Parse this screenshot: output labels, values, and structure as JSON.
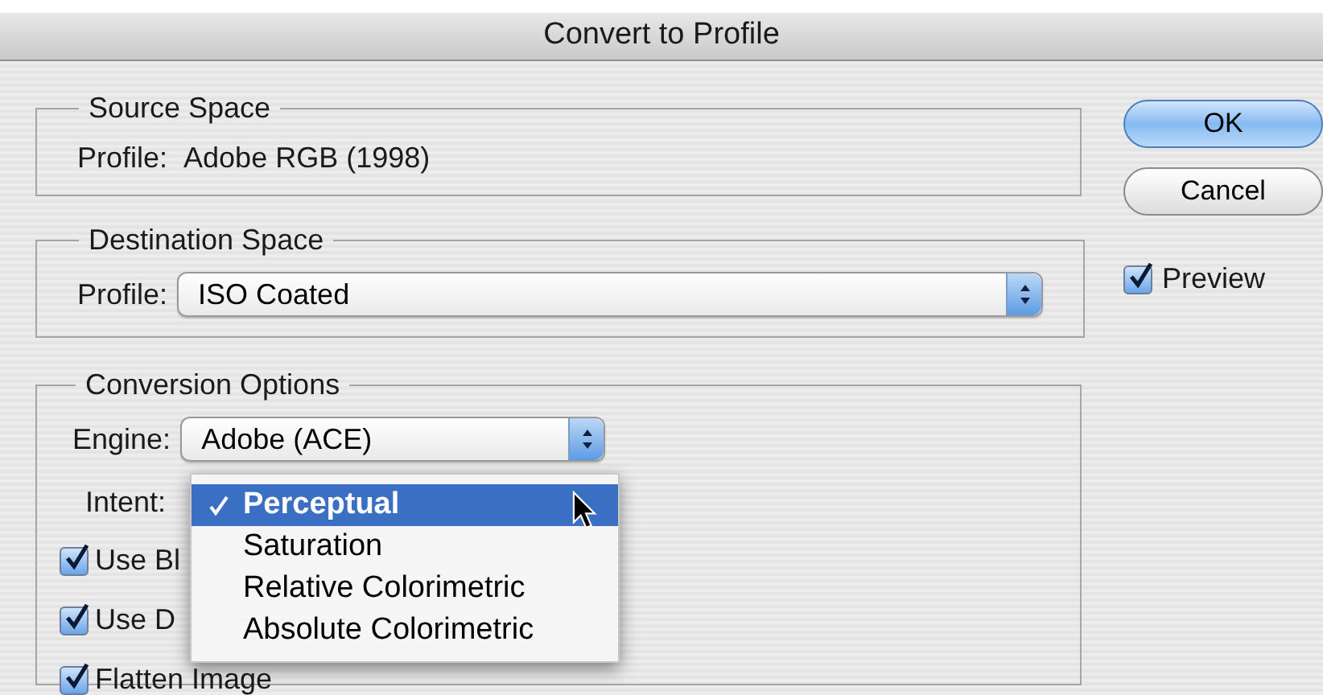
{
  "window": {
    "title": "Convert to Profile"
  },
  "source_space": {
    "legend": "Source Space",
    "label": "Profile:",
    "value": "Adobe RGB (1998)"
  },
  "destination_space": {
    "legend": "Destination Space",
    "label": "Profile:",
    "value": "ISO Coated"
  },
  "conversion_options": {
    "legend": "Conversion Options",
    "engine_label": "Engine:",
    "engine_value": "Adobe (ACE)",
    "intent_label": "Intent:",
    "checkboxes": [
      {
        "label": "Use Bl",
        "checked": true
      },
      {
        "label": "Use D",
        "checked": true
      },
      {
        "label": "Flatten Image",
        "checked": true
      }
    ]
  },
  "intent_menu": {
    "items": [
      {
        "label": "Perceptual",
        "selected": true
      },
      {
        "label": "Saturation",
        "selected": false
      },
      {
        "label": "Relative Colorimetric",
        "selected": false
      },
      {
        "label": "Absolute Colorimetric",
        "selected": false
      }
    ]
  },
  "buttons": [
    {
      "label": "OK",
      "kind": "default"
    },
    {
      "label": "Cancel",
      "kind": "normal"
    }
  ],
  "preview": {
    "label": "Preview",
    "checked": true
  }
}
